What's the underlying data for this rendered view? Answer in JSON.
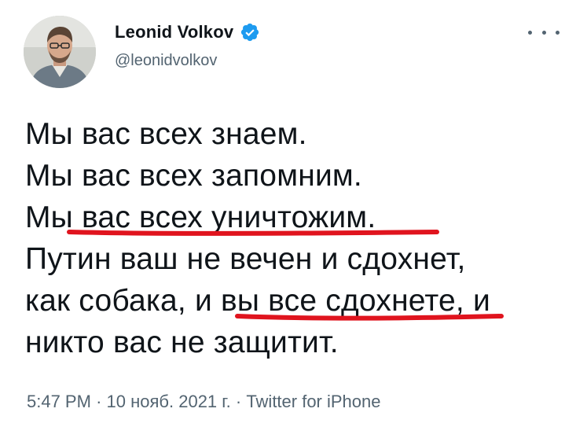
{
  "author": {
    "display_name": "Leonid Volkov",
    "handle": "@leonidvolkov",
    "verified": true,
    "avatar_icon": "user-avatar"
  },
  "tweet": {
    "lines": [
      "Мы вас всех знаем.",
      "Мы вас всех запомним.",
      "Мы вас всех уничтожим.",
      "Путин ваш не вечен и сдохнет,",
      "как собака, и вы все сдохнете, и",
      "никто вас не защитит."
    ]
  },
  "meta": {
    "time": "5:47 PM",
    "date": "10 нояб. 2021 г.",
    "source": "Twitter for iPhone",
    "separator": "·"
  },
  "colors": {
    "text": "#0f1419",
    "secondary": "#536471",
    "verified": "#1d9bf0",
    "underline_marks": "#e0141e"
  },
  "more_icon": "more-icon"
}
